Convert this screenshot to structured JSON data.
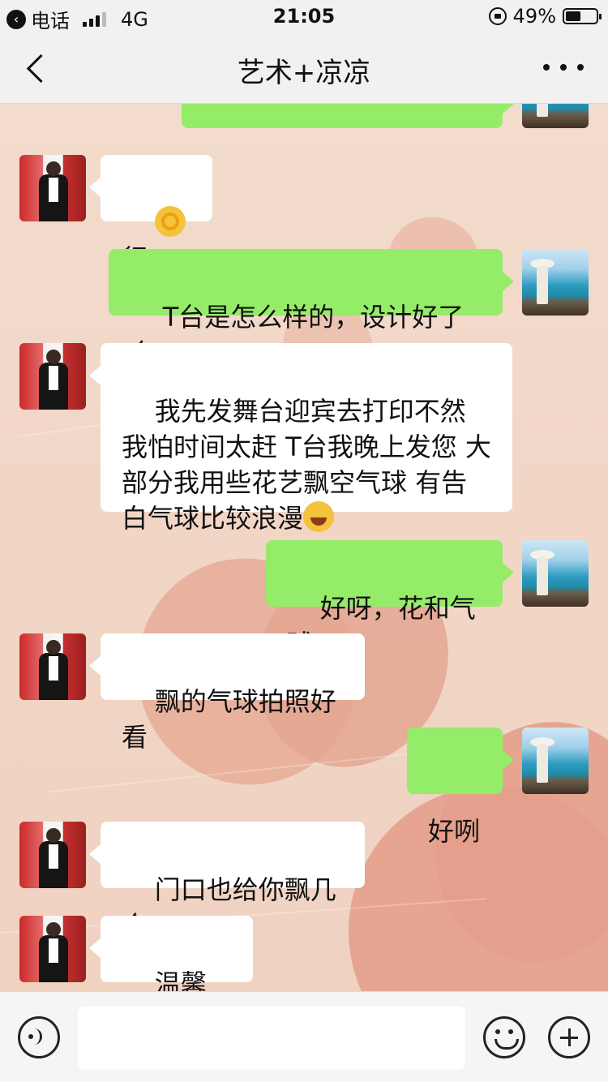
{
  "status_bar": {
    "carrier": "电话",
    "network": "4G",
    "time": "21:05",
    "battery_percent": "49%",
    "battery_level": 0.49,
    "icons": [
      "back-to-app-icon",
      "signal-icon",
      "orientation-lock-icon",
      "battery-icon"
    ]
  },
  "nav": {
    "title": "艺术+凉凉",
    "back_icon": "chevron-left-icon",
    "more_icon": "more-dots-icon"
  },
  "messages": [
    {
      "sender": "other",
      "text": "行",
      "emoji_before": "ok-hand-emoji"
    },
    {
      "sender": "me",
      "text": "T台是怎么样的，设计好了么"
    },
    {
      "sender": "other",
      "text": "我先发舞台迎宾去打印不然我怕时间太赶 T台我晚上发您 大部分我用些花艺飘空气球 有告白气球比较浪漫",
      "emoji_after": "tears-of-joy-emoji"
    },
    {
      "sender": "me",
      "text": "好呀，花和气球"
    },
    {
      "sender": "other",
      "text": "飘的气球拍照好看"
    },
    {
      "sender": "me",
      "text": "好咧"
    },
    {
      "sender": "other",
      "text": "门口也给你飘几个"
    },
    {
      "sender": "other",
      "text": "温馨一些"
    }
  ],
  "input_bar": {
    "value": "",
    "icons": [
      "voice-icon",
      "emoji-face-icon",
      "plus-circle-icon"
    ]
  },
  "colors": {
    "my_bubble": "#95ec69",
    "other_bubble": "#ffffff",
    "bar_bg": "#f1f1f1",
    "wallpaper_heart": "#e3a08c"
  }
}
